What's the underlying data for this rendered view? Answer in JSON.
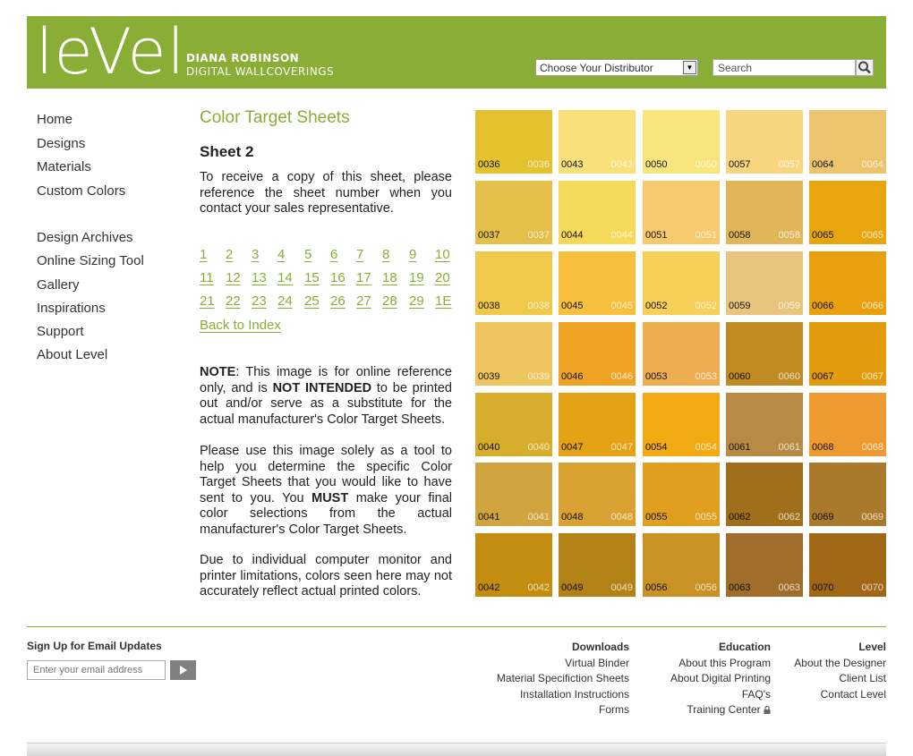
{
  "header": {
    "logo_word": "leVel",
    "logo_line1": "DIANA ROBINSON",
    "logo_line2": "DIGITAL WALLCOVERINGS",
    "distributor_select": "Choose Your Distributor",
    "search_placeholder": "Search"
  },
  "nav": {
    "group1": [
      "Home",
      "Designs",
      "Materials",
      "Custom Colors"
    ],
    "group2": [
      "Design Archives",
      "Online Sizing Tool",
      "Gallery",
      "Inspirations",
      "Support",
      "About Level"
    ]
  },
  "content": {
    "title": "Color Target Sheets",
    "sheet_title": "Sheet 2",
    "intro": "To receive a copy of this sheet, please reference the sheet number when you contact your sales representative.",
    "pages": [
      [
        "1",
        "2",
        "3",
        "4",
        "5",
        "6",
        "7",
        "8",
        "9",
        "10"
      ],
      [
        "11",
        "12",
        "13",
        "14",
        "15",
        "16",
        "17",
        "18",
        "19",
        "20"
      ],
      [
        "21",
        "22",
        "23",
        "24",
        "25",
        "26",
        "27",
        "28",
        "29",
        "1E"
      ]
    ],
    "back_link": "Back to Index",
    "note_label": "NOTE",
    "note_a": ": This image is for online reference only, and is ",
    "note_bold": "NOT INTENDED",
    "note_b": " to be printed out and/or serve as a substitute for the actual manufacturer's Color Target Sheets.",
    "use_a": "Please use this image solely as a tool to help you determine the specific Color Target Sheets that you would like to have sent to you. You ",
    "use_bold": "MUST",
    "use_b": " make your final color selections from the actual manufacturer's Color Target Sheets.",
    "due": "Due to individual computer monitor and printer limitations, colors seen here may not accurately reflect actual printed colors."
  },
  "swatches": [
    [
      {
        "code": "0036",
        "color": "#e3c12f"
      },
      {
        "code": "0043",
        "color": "#f9e07b"
      },
      {
        "code": "0050",
        "color": "#f8e57e"
      },
      {
        "code": "0057",
        "color": "#f7d67f"
      },
      {
        "code": "0064",
        "color": "#ebc46d"
      }
    ],
    [
      {
        "code": "0037",
        "color": "#e4c04a"
      },
      {
        "code": "0044",
        "color": "#f7d95a"
      },
      {
        "code": "0051",
        "color": "#f7c96e"
      },
      {
        "code": "0058",
        "color": "#e1b658"
      },
      {
        "code": "0065",
        "color": "#e8a60e"
      }
    ],
    [
      {
        "code": "0038",
        "color": "#f0c94b"
      },
      {
        "code": "0045",
        "color": "#f8bf3c"
      },
      {
        "code": "0052",
        "color": "#f8cf58"
      },
      {
        "code": "0059",
        "color": "#e8c47d"
      },
      {
        "code": "0066",
        "color": "#e8a00e"
      }
    ],
    [
      {
        "code": "0039",
        "color": "#eec45c"
      },
      {
        "code": "0046",
        "color": "#f0a426"
      },
      {
        "code": "0053",
        "color": "#efad52"
      },
      {
        "code": "0060",
        "color": "#c18b24"
      },
      {
        "code": "0067",
        "color": "#e39b0e"
      }
    ],
    [
      {
        "code": "0040",
        "color": "#d7ad2c"
      },
      {
        "code": "0047",
        "color": "#e4a314"
      },
      {
        "code": "0054",
        "color": "#f2aa12"
      },
      {
        "code": "0061",
        "color": "#b88b45"
      },
      {
        "code": "0068",
        "color": "#ef9a31"
      }
    ],
    [
      {
        "code": "0041",
        "color": "#d0a53d"
      },
      {
        "code": "0048",
        "color": "#d9a232"
      },
      {
        "code": "0055",
        "color": "#e09f1f"
      },
      {
        "code": "0062",
        "color": "#9f6f1c"
      },
      {
        "code": "0069",
        "color": "#aa7a2c"
      }
    ],
    [
      {
        "code": "0042",
        "color": "#c48d10"
      },
      {
        "code": "0049",
        "color": "#b38217"
      },
      {
        "code": "0056",
        "color": "#c89224"
      },
      {
        "code": "0063",
        "color": "#a06d2a"
      },
      {
        "code": "0070",
        "color": "#9f6716"
      }
    ]
  ],
  "footer": {
    "signup_title": "Sign Up for Email Updates",
    "email_placeholder": "Enter your email address",
    "downloads": {
      "title": "Downloads",
      "items": [
        "Virtual Binder",
        "Material Specifiction Sheets",
        "Installation Instructions",
        "Forms"
      ]
    },
    "education": {
      "title": "Education",
      "items": [
        "About this Program",
        "About Digital Printing",
        "FAQ's",
        "Training Center"
      ]
    },
    "level": {
      "title": "Level",
      "items": [
        "About the Designer",
        "Client List",
        "Contact Level"
      ]
    }
  }
}
